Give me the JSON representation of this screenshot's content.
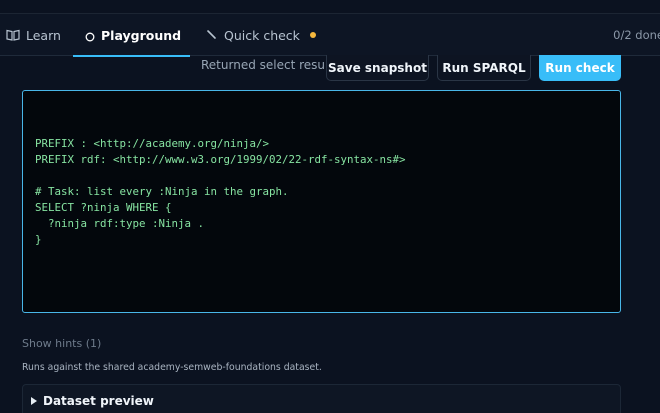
{
  "tabs": [
    {
      "label": "Learn",
      "icon": "book-icon",
      "active": false
    },
    {
      "label": "Playground",
      "icon": "circle-icon",
      "active": true,
      "badge": true
    },
    {
      "label": "Quick check",
      "icon": "pencil-icon",
      "active": false,
      "badge": true
    }
  ],
  "progress": "0/2 done",
  "toolbar": {
    "status": "Returned select result.",
    "save_label": "Save snapshot",
    "run_sparql_label": "Run SPARQL",
    "run_check_label": "Run check"
  },
  "editor": {
    "code": "PREFIX : <http://academy.org/ninja/>\nPREFIX rdf: <http://www.w3.org/1999/02/22-rdf-syntax-ns#>\n\n# Task: list every :Ninja in the graph.\nSELECT ?ninja WHERE {\n  ?ninja rdf:type :Ninja .\n}"
  },
  "hints_label": "Show hints (1)",
  "dataset_note": "Runs against the shared academy-semweb-foundations dataset.",
  "dataset_preview_label": "Dataset preview",
  "colors": {
    "accent": "#38bdf8",
    "badge": "#f5b83d",
    "code": "#86e3a1",
    "background": "#0b1220"
  }
}
